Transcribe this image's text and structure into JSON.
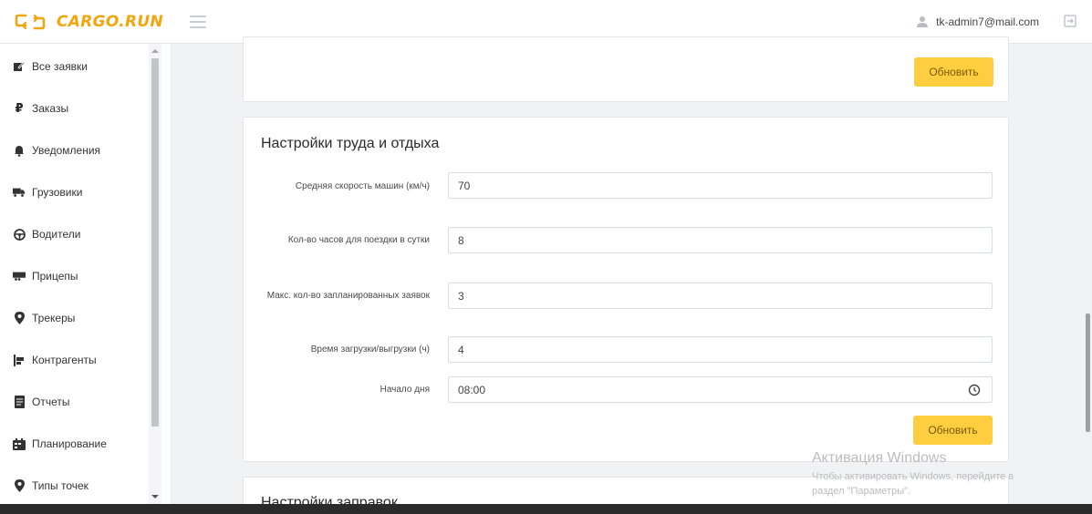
{
  "header": {
    "brand": "CARGO.RUN",
    "user_email": "tk-admin7@mail.com"
  },
  "sidebar": {
    "items": [
      {
        "label": "Все заявки",
        "icon": "edit-icon"
      },
      {
        "label": "Заказы",
        "icon": "ruble-icon"
      },
      {
        "label": "Уведомления",
        "icon": "bell-icon"
      },
      {
        "label": "Грузовики",
        "icon": "truck-icon"
      },
      {
        "label": "Водители",
        "icon": "steering-wheel-icon"
      },
      {
        "label": "Прицепы",
        "icon": "trailer-icon"
      },
      {
        "label": "Трекеры",
        "icon": "map-marker-icon"
      },
      {
        "label": "Контрагенты",
        "icon": "contractors-icon"
      },
      {
        "label": "Отчеты",
        "icon": "report-icon"
      },
      {
        "label": "Планирование",
        "icon": "calendar-icon"
      },
      {
        "label": "Типы точек",
        "icon": "map-marker-icon"
      }
    ]
  },
  "top_card": {
    "button_label": "Обновить"
  },
  "work_rest": {
    "title": "Настройки труда и отдыха",
    "fields": [
      {
        "label": "Средняя скорость машин (км/ч)",
        "value": "70"
      },
      {
        "label": "Кол-во часов для поездки в сутки",
        "value": "8"
      },
      {
        "label": "Макс. кол-во запланированных заявок",
        "value": "3"
      },
      {
        "label": "Время загрузки/выгрузки (ч)",
        "value": "4"
      },
      {
        "label": "Начало дня",
        "value": "08:00"
      }
    ],
    "button_label": "Обновить"
  },
  "fuel": {
    "title": "Настройки заправок"
  },
  "windows_watermark": {
    "title": "Активация Windows",
    "line1": "Чтобы активировать Windows, перейдите в",
    "line2": "раздел \"Параметры\"."
  },
  "colors": {
    "brand": "#f2a60d",
    "button": "#ffcd40"
  }
}
